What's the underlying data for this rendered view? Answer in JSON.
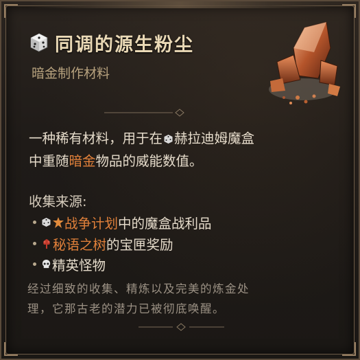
{
  "item": {
    "name": "同调的源生粉尘",
    "type": "暗金制作材料",
    "name_color": "#ead9b6",
    "accent_orange": "#e0803a",
    "icon": "cube-icon"
  },
  "description": {
    "line1_pre": "一种稀有材料，用于在",
    "line1_post": "赫拉迪姆魔盒",
    "line2_pre": "中重随",
    "line2_highlight": "暗金",
    "line2_post": "物品的威能数值。"
  },
  "sources": {
    "heading": "收集来源:",
    "items": [
      {
        "highlight": "战争计划",
        "text": "中的魔盒战利品",
        "icons": [
          "cube-icon",
          "war-plan-icon"
        ]
      },
      {
        "highlight": "秘语之树",
        "text": "的宝匣奖励",
        "icons": [
          "tree-whispers-icon"
        ]
      },
      {
        "highlight": "",
        "text": "精英怪物",
        "icons": [
          "skull-icon"
        ]
      }
    ]
  },
  "flavor": {
    "line1": "经过细致的收集、精炼以及完美的炼金处",
    "line2": "理，它那古老的潜力已被彻底唤醒。"
  }
}
